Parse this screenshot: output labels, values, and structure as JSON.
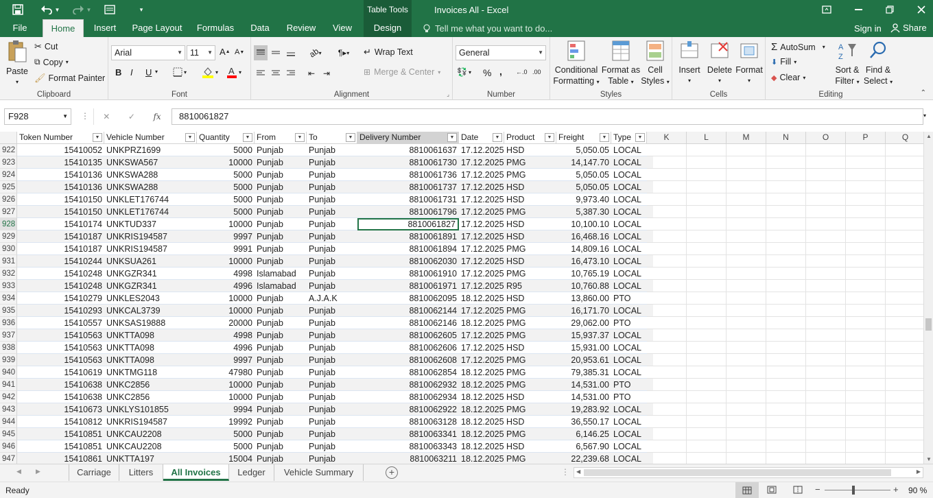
{
  "window": {
    "title": "Invoices All - Excel",
    "context_tab": "Table Tools",
    "sign_in": "Sign in",
    "share": "Share",
    "tell_me": "Tell me what you want to do..."
  },
  "tabs": [
    "File",
    "Home",
    "Insert",
    "Page Layout",
    "Formulas",
    "Data",
    "Review",
    "View",
    "Design"
  ],
  "ribbon": {
    "clipboard": {
      "paste": "Paste",
      "cut": "Cut",
      "copy": "Copy",
      "format_painter": "Format Painter",
      "label": "Clipboard"
    },
    "font": {
      "family": "Arial",
      "size": "11",
      "bold": "B",
      "italic": "I",
      "underline": "U",
      "label": "Font"
    },
    "alignment": {
      "wrap_text": "Wrap Text",
      "merge_center": "Merge & Center",
      "label": "Alignment"
    },
    "number": {
      "format": "General",
      "percent": "%",
      "comma": ",",
      "label": "Number"
    },
    "styles": {
      "conditional": "Conditional",
      "conditional2": "Formatting",
      "format_as": "Format as",
      "format_as2": "Table",
      "cell_styles": "Cell",
      "cell_styles2": "Styles",
      "label": "Styles"
    },
    "cells": {
      "insert": "Insert",
      "delete": "Delete",
      "format": "Format",
      "label": "Cells"
    },
    "editing": {
      "autosum": "AutoSum",
      "fill": "Fill",
      "clear": "Clear",
      "sort": "Sort &",
      "sort2": "Filter",
      "find": "Find &",
      "find2": "Select",
      "label": "Editing"
    }
  },
  "formula_bar": {
    "name_box": "F928",
    "fx": "fx",
    "value": "8810061827"
  },
  "columns": [
    {
      "name": "Token Number"
    },
    {
      "name": "Vehicle Number"
    },
    {
      "name": "Quantity"
    },
    {
      "name": "From"
    },
    {
      "name": "To"
    },
    {
      "name": "Delivery Number"
    },
    {
      "name": "Date"
    },
    {
      "name": "Product"
    },
    {
      "name": "Freight"
    },
    {
      "name": "Type"
    }
  ],
  "extra_columns": [
    "K",
    "L",
    "M",
    "N",
    "O",
    "P",
    "Q"
  ],
  "selected_row": "928",
  "rows": [
    [
      "922",
      "15410052",
      "UNKPRZ1699",
      "5000",
      "Punjab",
      "Punjab",
      "8810061637",
      "17.12.2025",
      "HSD",
      "5,050.05",
      "LOCAL"
    ],
    [
      "923",
      "15410135",
      "UNKSWA567",
      "10000",
      "Punjab",
      "Punjab",
      "8810061730",
      "17.12.2025",
      "PMG",
      "14,147.70",
      "LOCAL"
    ],
    [
      "924",
      "15410136",
      "UNKSWA288",
      "5000",
      "Punjab",
      "Punjab",
      "8810061736",
      "17.12.2025",
      "PMG",
      "5,050.05",
      "LOCAL"
    ],
    [
      "925",
      "15410136",
      "UNKSWA288",
      "5000",
      "Punjab",
      "Punjab",
      "8810061737",
      "17.12.2025",
      "HSD",
      "5,050.05",
      "LOCAL"
    ],
    [
      "926",
      "15410150",
      "UNKLET176744",
      "5000",
      "Punjab",
      "Punjab",
      "8810061731",
      "17.12.2025",
      "HSD",
      "9,973.40",
      "LOCAL"
    ],
    [
      "927",
      "15410150",
      "UNKLET176744",
      "5000",
      "Punjab",
      "Punjab",
      "8810061796",
      "17.12.2025",
      "PMG",
      "5,387.30",
      "LOCAL"
    ],
    [
      "928",
      "15410174",
      "UNKTUD337",
      "10000",
      "Punjab",
      "Punjab",
      "8810061827",
      "17.12.2025",
      "HSD",
      "10,100.10",
      "LOCAL"
    ],
    [
      "929",
      "15410187",
      "UNKRIS194587",
      "9997",
      "Punjab",
      "Punjab",
      "8810061891",
      "17.12.2025",
      "HSD",
      "16,468.16",
      "LOCAL"
    ],
    [
      "930",
      "15410187",
      "UNKRIS194587",
      "9991",
      "Punjab",
      "Punjab",
      "8810061894",
      "17.12.2025",
      "PMG",
      "14,809.16",
      "LOCAL"
    ],
    [
      "931",
      "15410244",
      "UNKSUA261",
      "10000",
      "Punjab",
      "Punjab",
      "8810062030",
      "17.12.2025",
      "HSD",
      "16,473.10",
      "LOCAL"
    ],
    [
      "932",
      "15410248",
      "UNKGZR341",
      "4998",
      "Islamabad",
      "Punjab",
      "8810061910",
      "17.12.2025",
      "PMG",
      "10,765.19",
      "LOCAL"
    ],
    [
      "933",
      "15410248",
      "UNKGZR341",
      "4996",
      "Islamabad",
      "Punjab",
      "8810061971",
      "17.12.2025",
      "R95",
      "10,760.88",
      "LOCAL"
    ],
    [
      "934",
      "15410279",
      "UNKLES2043",
      "10000",
      "Punjab",
      "A.J.A.K",
      "8810062095",
      "18.12.2025",
      "HSD",
      "13,860.00",
      "PTO"
    ],
    [
      "935",
      "15410293",
      "UNKCAL3739",
      "10000",
      "Punjab",
      "Punjab",
      "8810062144",
      "17.12.2025",
      "PMG",
      "16,171.70",
      "LOCAL"
    ],
    [
      "936",
      "15410557",
      "UNKSAS19888",
      "20000",
      "Punjab",
      "Punjab",
      "8810062146",
      "18.12.2025",
      "PMG",
      "29,062.00",
      "PTO"
    ],
    [
      "937",
      "15410563",
      "UNKTTA098",
      "4998",
      "Punjab",
      "Punjab",
      "8810062605",
      "17.12.2025",
      "PMG",
      "15,937.37",
      "LOCAL"
    ],
    [
      "938",
      "15410563",
      "UNKTTA098",
      "4996",
      "Punjab",
      "Punjab",
      "8810062606",
      "17.12.2025",
      "HSD",
      "15,931.00",
      "LOCAL"
    ],
    [
      "939",
      "15410563",
      "UNKTTA098",
      "9997",
      "Punjab",
      "Punjab",
      "8810062608",
      "17.12.2025",
      "PMG",
      "20,953.61",
      "LOCAL"
    ],
    [
      "940",
      "15410619",
      "UNKTMG118",
      "47980",
      "Punjab",
      "Punjab",
      "8810062854",
      "18.12.2025",
      "PMG",
      "79,385.31",
      "LOCAL"
    ],
    [
      "941",
      "15410638",
      "UNKC2856",
      "10000",
      "Punjab",
      "Punjab",
      "8810062932",
      "18.12.2025",
      "PMG",
      "14,531.00",
      "PTO"
    ],
    [
      "942",
      "15410638",
      "UNKC2856",
      "10000",
      "Punjab",
      "Punjab",
      "8810062934",
      "18.12.2025",
      "HSD",
      "14,531.00",
      "PTO"
    ],
    [
      "943",
      "15410673",
      "UNKLYS101855",
      "9994",
      "Punjab",
      "Punjab",
      "8810062922",
      "18.12.2025",
      "PMG",
      "19,283.92",
      "LOCAL"
    ],
    [
      "944",
      "15410812",
      "UNKRIS194587",
      "19992",
      "Punjab",
      "Punjab",
      "8810063128",
      "18.12.2025",
      "HSD",
      "36,550.17",
      "LOCAL"
    ],
    [
      "945",
      "15410851",
      "UNKCAU2208",
      "5000",
      "Punjab",
      "Punjab",
      "8810063341",
      "18.12.2025",
      "PMG",
      "6,146.25",
      "LOCAL"
    ],
    [
      "946",
      "15410851",
      "UNKCAU2208",
      "5000",
      "Punjab",
      "Punjab",
      "8810063343",
      "18.12.2025",
      "HSD",
      "6,567.90",
      "LOCAL"
    ],
    [
      "947",
      "15410861",
      "UNKTTA197",
      "15004",
      "Punjab",
      "Punjab",
      "8810063211",
      "18.12.2025",
      "PMG",
      "22,239.68",
      "LOCAL"
    ]
  ],
  "sheet_tabs": [
    "Carriage",
    "Litters",
    "All Invoices",
    "Ledger",
    "Vehicle Summary"
  ],
  "active_sheet": "All Invoices",
  "status": {
    "ready": "Ready",
    "zoom": "90 %"
  },
  "colors": {
    "accent": "#217346",
    "ribbon_bg": "#f3f3f3"
  }
}
